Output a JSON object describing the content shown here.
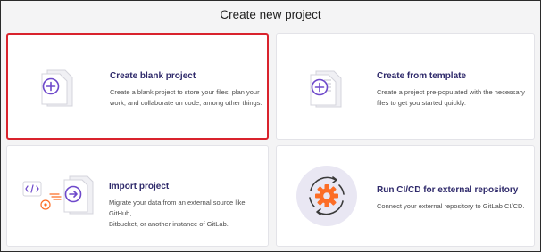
{
  "page": {
    "title": "Create new project"
  },
  "cards": [
    {
      "title": "Create blank project",
      "description": "Create a blank project to store your files, plan your\nwork, and collaborate on code, among other things.",
      "icon": "blank-project-icon",
      "selected": true
    },
    {
      "title": "Create from template",
      "description": "Create a project pre-populated with the necessary\nfiles to get you started quickly.",
      "icon": "template-project-icon",
      "selected": false
    },
    {
      "title": "Import project",
      "description": "Migrate your data from an external source like GitHub,\nBitbucket, or another instance of GitLab.",
      "icon": "import-project-icon",
      "selected": false
    },
    {
      "title": "Run CI/CD for external repository",
      "description": "Connect your external repository to GitLab CI/CD.",
      "icon": "cicd-gear-icon",
      "selected": false
    }
  ],
  "colors": {
    "accent": "#6e49cb",
    "title_text": "#2f2a6b",
    "selection_border": "#d9232d",
    "cicd_circle": "#e9e7f3",
    "cicd_gear": "#fc6d26"
  }
}
